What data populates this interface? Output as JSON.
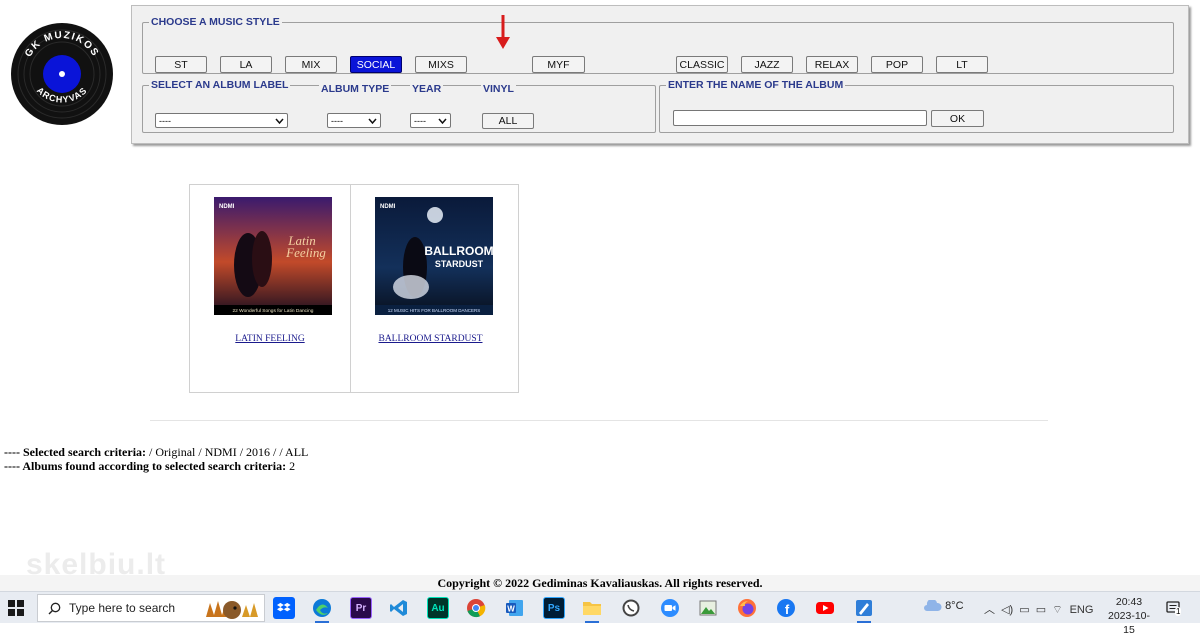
{
  "logo": {
    "top_text": "GK MUZIKOS",
    "bottom_text": "ARCHYVAS"
  },
  "music_style": {
    "legend": "CHOOSE A MUSIC STYLE",
    "buttons": [
      "ST",
      "LA",
      "MIX",
      "SOCIAL",
      "MIXS",
      "MYF",
      "CLASSIC",
      "JAZZ",
      "RELAX",
      "POP",
      "LT"
    ],
    "selected": "SOCIAL"
  },
  "filters": {
    "album_label": {
      "label": "SELECT AN ALBUM LABEL",
      "value": "----"
    },
    "album_type": {
      "label": "ALBUM TYPE",
      "value": "----"
    },
    "year": {
      "label": "YEAR",
      "value": "----"
    },
    "vinyl": {
      "label": "VINYL",
      "button": "ALL"
    }
  },
  "album_name": {
    "legend": "ENTER THE NAME OF THE ALBUM",
    "value": "",
    "ok_label": "OK"
  },
  "albums": [
    {
      "title": "LATIN FEELING",
      "cover_badge": "NDMI",
      "cover_line1": "Latin",
      "cover_line2": "Feeling",
      "cover_caption": "22 Wonderful Songs for Latin Dancing"
    },
    {
      "title": "BALLROOM STARDUST",
      "cover_badge": "NDMI",
      "cover_line1": "BALLROOM",
      "cover_line2": "STARDUST",
      "cover_caption": "12 MUSIC HITS FOR BALLROOM DANCERS"
    }
  ],
  "criteria": {
    "selected_label": "---- Selected search criteria:",
    "selected_value": "/ Original / NDMI / 2016 / / ALL",
    "found_label": "---- Albums found according to selected search criteria:",
    "found_value": "2"
  },
  "watermark": "skelbiu.lt",
  "copyright": "Copyright © 2022 Gediminas Kavaliauskas. All rights reserved.",
  "taskbar": {
    "search_placeholder": "Type here to search",
    "apps": [
      "dropbox-icon",
      "edge-icon",
      "premiere-icon",
      "vscode-icon",
      "audition-icon",
      "chrome-icon",
      "word-icon",
      "photoshop-icon",
      "file-explorer-icon",
      "whatsapp-icon",
      "zoom-icon",
      "photos-icon",
      "firefox-icon",
      "facebook-icon",
      "youtube-icon",
      "paint-icon"
    ],
    "weather": "8°C",
    "language": "ENG",
    "time": "20:43",
    "date": "2023-10-15",
    "notifications": "1"
  },
  "colors": {
    "accent": "#0a14d8",
    "legend_text": "#2b3a8c",
    "link": "#1a1a8c"
  }
}
